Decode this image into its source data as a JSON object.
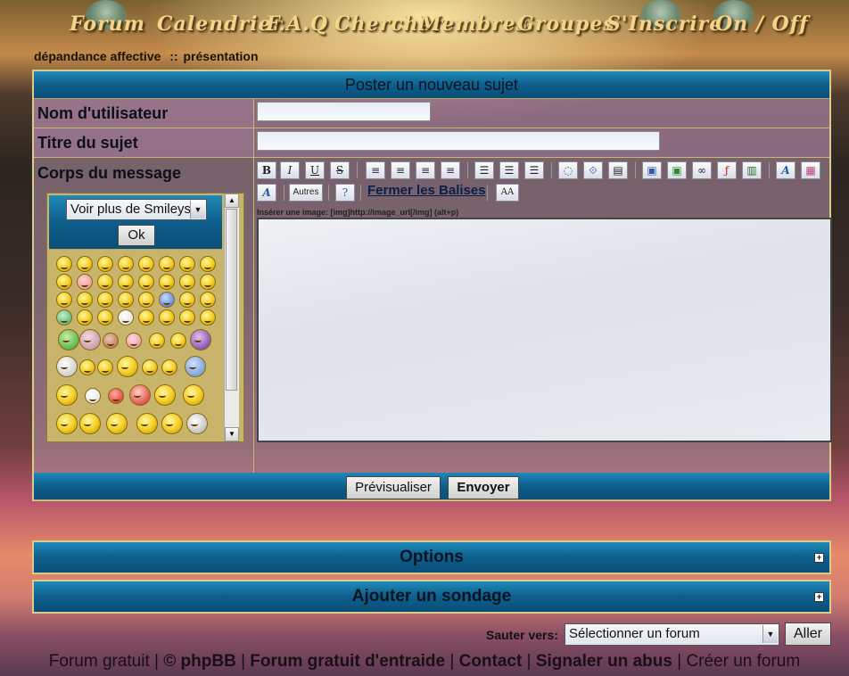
{
  "nav": {
    "items": [
      "Forum",
      "Calendrier",
      "F.A.Q",
      "Chercher",
      "Membres",
      "Groupes",
      "S'Inscrire",
      "On / Off"
    ]
  },
  "breadcrumb": {
    "forum": "dépandance affective",
    "sep": "::",
    "sub": "présentation"
  },
  "post": {
    "title": "Poster un nouveau sujet",
    "username_label": "Nom d'utilisateur",
    "subject_label": "Titre du sujet",
    "body_label": "Corps du message",
    "smileys_select": "Voir plus de Smileys",
    "ok_label": "Ok",
    "toolbar": {
      "bold": "B",
      "italic": "I",
      "underline": "U",
      "strike": "S",
      "autres": "Autres",
      "fermer": "Fermer les Balises",
      "font_size_icon": "AA"
    },
    "hint": "Insérer une image: [img]http://image_url[/img] (alt+p)",
    "preview_label": "Prévisualiser",
    "send_label": "Envoyer"
  },
  "options_label": "Options",
  "poll_label": "Ajouter un sondage",
  "jump": {
    "label": "Sauter vers:",
    "select": "Sélectionner un forum",
    "go": "Aller"
  },
  "footer": {
    "forum_gratuit": "Forum gratuit",
    "copyright": "© phpBB",
    "entraide": "Forum gratuit d'entraide",
    "contact": "Contact",
    "abus": "Signaler un abus",
    "creer": "Créer un forum",
    "sep": "|"
  },
  "colors": {
    "bar": "#0e5e8c",
    "border": "#d9cc8a",
    "nav_text": "#f2d58a"
  }
}
